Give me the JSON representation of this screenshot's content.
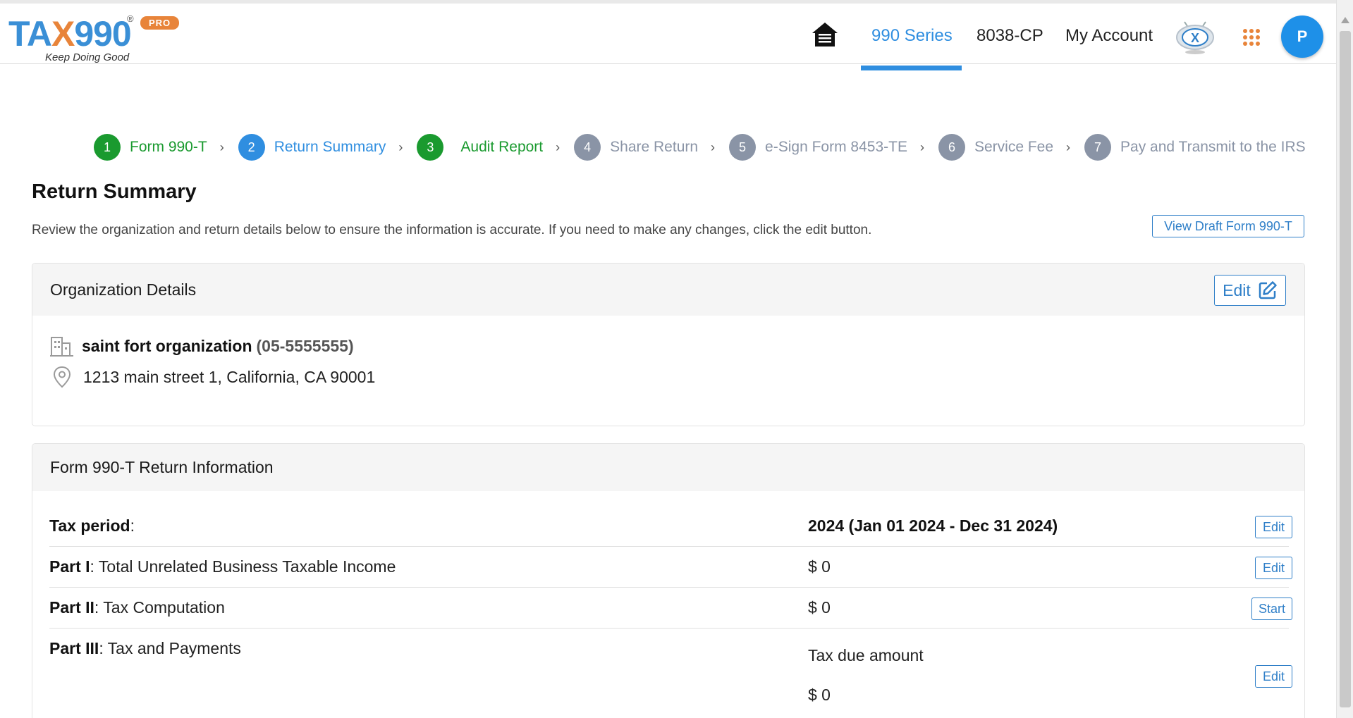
{
  "header": {
    "logo": {
      "text_main": "TA",
      "text_x": "X",
      "text_num": "990",
      "reg": "®",
      "badge": "PRO",
      "tagline": "Keep Doing Good"
    },
    "nav": {
      "home_icon": "home-icon",
      "links": [
        "990 Series",
        "8038-CP",
        "My Account"
      ],
      "active": "990 Series",
      "apps_icon": "grid-icon",
      "avatar_initial": "P"
    }
  },
  "steps": [
    {
      "num": "1",
      "label": "Form 990-T",
      "state": "done"
    },
    {
      "num": "2",
      "label": "Return Summary",
      "state": "current"
    },
    {
      "num": "3",
      "label": "Audit Report",
      "state": "done"
    },
    {
      "num": "4",
      "label": "Share Return",
      "state": "todo"
    },
    {
      "num": "5",
      "label": "e-Sign Form 8453-TE",
      "state": "todo"
    },
    {
      "num": "6",
      "label": "Service Fee",
      "state": "todo"
    },
    {
      "num": "7",
      "label": "Pay and Transmit to the IRS",
      "state": "todo"
    }
  ],
  "page": {
    "title": "Return Summary",
    "description": "Review the organization and return details below to ensure the information is accurate. If you need to make any changes, click the edit button.",
    "view_draft_label": "View Draft Form 990-T"
  },
  "org": {
    "heading": "Organization Details",
    "edit_label": "Edit",
    "name": "saint fort organization",
    "ein": "(05-5555555)",
    "address": "1213 main street 1, California, CA 90001"
  },
  "return_info": {
    "heading": "Form 990-T Return Information",
    "rows": [
      {
        "bold": "Tax period",
        "rest": ":",
        "value": "2024 (Jan 01 2024 - Dec 31 2024)",
        "action": "Edit"
      },
      {
        "bold": "Part I",
        "rest": ": Total Unrelated Business Taxable Income",
        "value": "$ 0",
        "action": "Edit"
      },
      {
        "bold": "Part II",
        "rest": ": Tax Computation",
        "value": "$ 0",
        "action": "Start"
      },
      {
        "bold": "Part III",
        "rest": ": Tax and Payments",
        "sub_label": "Tax due amount",
        "value": "$ 0",
        "action": "Edit"
      }
    ]
  },
  "colors": {
    "primary": "#2f8ee0",
    "done_green": "#1a9a2f",
    "todo_gray": "#8a94a6",
    "brand_orange": "#e8843a"
  }
}
